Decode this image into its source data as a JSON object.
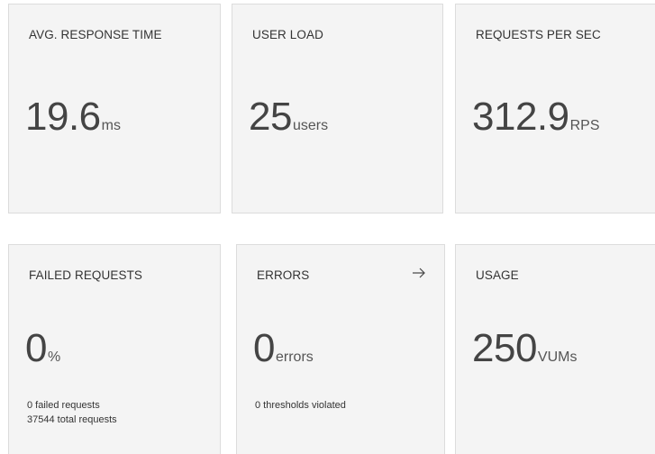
{
  "cards": {
    "avg_response_time": {
      "title": "AVG. RESPONSE TIME",
      "value": "19.6",
      "unit": "ms"
    },
    "user_load": {
      "title": "USER LOAD",
      "value": "25",
      "unit": "users"
    },
    "requests_per_sec": {
      "title": "REQUESTS PER SEC",
      "value": "312.9",
      "unit": "RPS"
    },
    "failed_requests": {
      "title": "FAILED REQUESTS",
      "value": "0",
      "unit": "%",
      "detail_1": "0 failed requests",
      "detail_2": "37544 total requests"
    },
    "errors": {
      "title": "ERRORS",
      "value": "0",
      "unit": "errors",
      "detail_1": "0 thresholds violated",
      "arrow_icon": "arrow-right-icon"
    },
    "usage": {
      "title": "USAGE",
      "value": "250",
      "unit": "VUMs"
    }
  },
  "colors": {
    "card_background": "#f4f4f4",
    "card_border": "#dcdcdc",
    "text": "#333333"
  }
}
